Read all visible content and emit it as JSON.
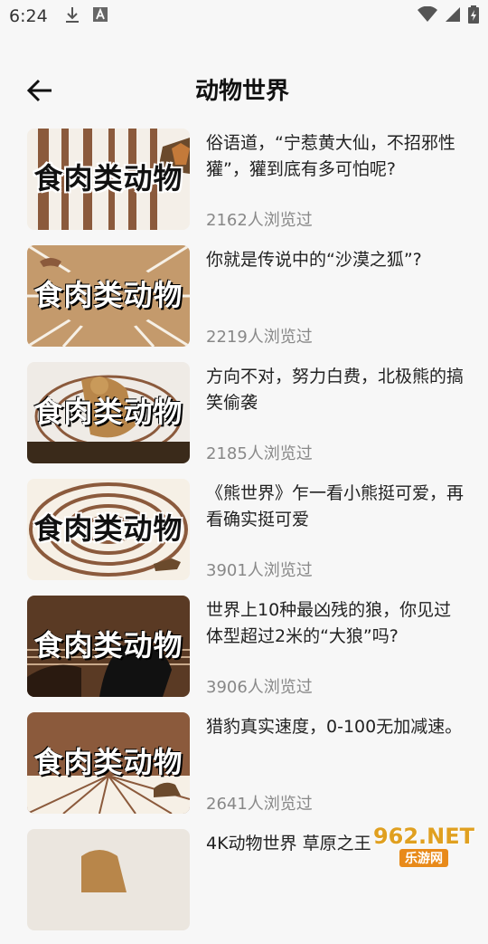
{
  "status_bar": {
    "time": "6:24"
  },
  "header": {
    "title": "动物世界"
  },
  "thumb_text": "食肉类动物",
  "items": [
    {
      "title": "俗语道，“宁惹黄大仙，不招邪性獾”，獾到底有多可怕呢?",
      "views": "2162人浏览过"
    },
    {
      "title": "你就是传说中的“沙漠之狐”?",
      "views": "2219人浏览过"
    },
    {
      "title": "方向不对，努力白费，北极熊的搞笑偷袭",
      "views": "2185人浏览过"
    },
    {
      "title": "《熊世界》乍一看小熊挺可爱，再看确实挺可爱",
      "views": "3901人浏览过"
    },
    {
      "title": "世界上10种最凶残的狼，你见过体型超过2米的“大狼”吗?",
      "views": "3906人浏览过"
    },
    {
      "title": "猎豹真实速度，0-100无加减速。",
      "views": "2641人浏览过"
    },
    {
      "title": "4K动物世界 草原之王",
      "views": ""
    }
  ],
  "watermark": {
    "top": "962.NET",
    "bottom": "乐游网"
  },
  "colors": {
    "brown": "#8b5a3c",
    "tan": "#c49a6c",
    "cream": "#f6f0e6"
  }
}
